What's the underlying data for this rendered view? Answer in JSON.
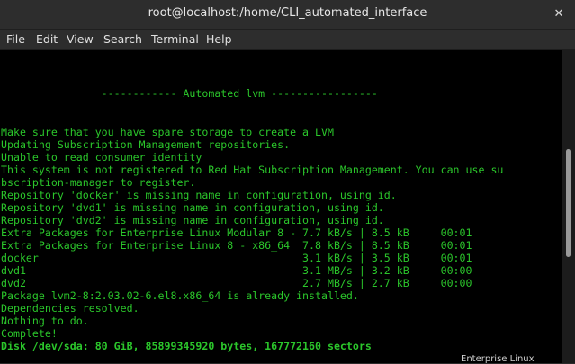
{
  "window": {
    "title": "root@localhost:/home/CLI_automated_interface",
    "close_symbol": "✕"
  },
  "menu": {
    "items": [
      "File",
      "Edit",
      "View",
      "Search",
      "Terminal",
      "Help"
    ]
  },
  "terminal": {
    "lines": [
      "                ------------ Automated lvm -----------------",
      "",
      "Make sure that you have spare storage to create a LVM",
      "Updating Subscription Management repositories.",
      "Unable to read consumer identity",
      "This system is not registered to Red Hat Subscription Management. You can use su",
      "bscription-manager to register.",
      "Repository 'docker' is missing name in configuration, using id.",
      "Repository 'dvd1' is missing name in configuration, using id.",
      "Repository 'dvd2' is missing name in configuration, using id.",
      "Extra Packages for Enterprise Linux Modular 8 - 7.7 kB/s | 8.5 kB     00:01",
      "Extra Packages for Enterprise Linux 8 - x86_64  7.8 kB/s | 8.5 kB     00:01",
      "docker                                          3.1 kB/s | 3.5 kB     00:01",
      "dvd1                                            3.1 MB/s | 3.2 kB     00:00",
      "dvd2                                            2.7 MB/s | 2.7 kB     00:00",
      "Package lvm2-8:2.03.02-6.el8.x86_64 is already installed.",
      "Dependencies resolved.",
      "Nothing to do.",
      "Complete!",
      "Disk /dev/sda: 80 GiB, 85899345920 bytes, 167772160 sectors"
    ]
  },
  "background_window": {
    "partial_text": "Enterprise Linux"
  },
  "colors": {
    "terminal_fg": "#2bc62b",
    "terminal_bg": "#000000",
    "chrome_bg": "#2d2d2d"
  },
  "icons": {
    "close": "close-icon"
  }
}
